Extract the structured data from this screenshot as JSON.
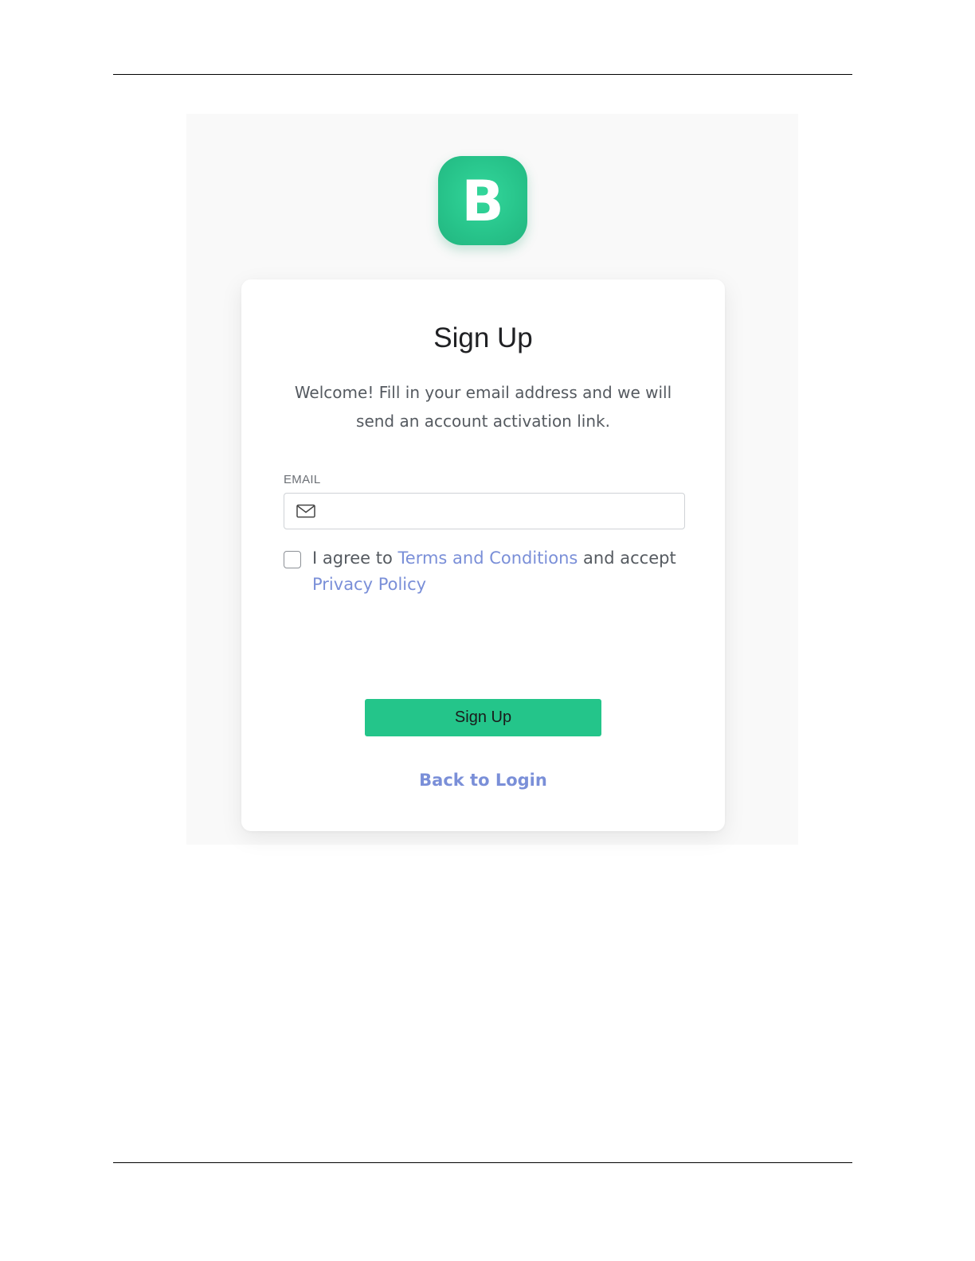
{
  "logo": {
    "letter": "B",
    "color": "#27c38a"
  },
  "signup": {
    "title": "Sign Up",
    "intro": "Welcome! Fill in your email address and we will send an account activation link.",
    "email_label": "EMAIL",
    "email_value": "",
    "email_icon": "mail-icon",
    "agree_prefix": "I agree to ",
    "terms_link": "Terms and Conditions",
    "agree_middle": " and accept ",
    "privacy_link": "Privacy Policy",
    "checkbox_checked": false,
    "button_label": "Sign Up",
    "back_label": "Back to Login"
  },
  "colors": {
    "accent": "#24c58a",
    "link": "#7a8fd8"
  }
}
